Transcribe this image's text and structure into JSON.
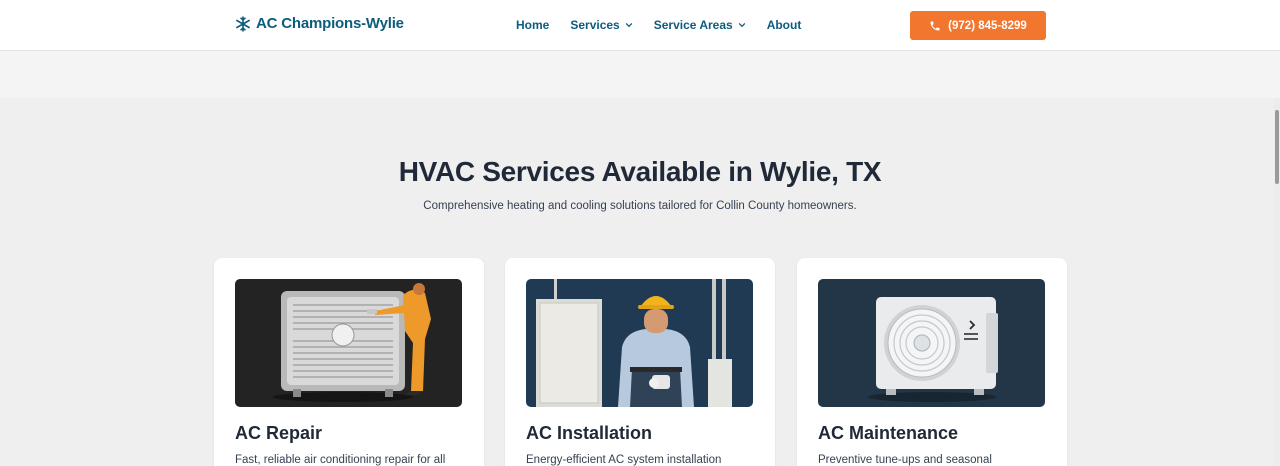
{
  "header": {
    "logo_text": "AC Champions-Wylie",
    "logo_icon": "snowflake-icon",
    "nav": [
      {
        "label": "Home"
      },
      {
        "label": "Services"
      },
      {
        "label": "Service Areas"
      },
      {
        "label": "About"
      }
    ],
    "phone_label": "(972) 845-8299",
    "phone_icon": "phone-icon"
  },
  "section": {
    "title": "HVAC Services Available in Wylie, TX",
    "subtitle": "Comprehensive heating and cooling solutions tailored for Collin County homeowners."
  },
  "cards": [
    {
      "title": "AC Repair",
      "description": "Fast, reliable air conditioning repair for all"
    },
    {
      "title": "AC Installation",
      "description": "Energy-efficient AC system installation"
    },
    {
      "title": "AC Maintenance",
      "description": "Preventive tune-ups and seasonal"
    }
  ],
  "colors": {
    "brand": "#0d5c7d",
    "accent": "#f2762e",
    "background": "#efefef"
  }
}
